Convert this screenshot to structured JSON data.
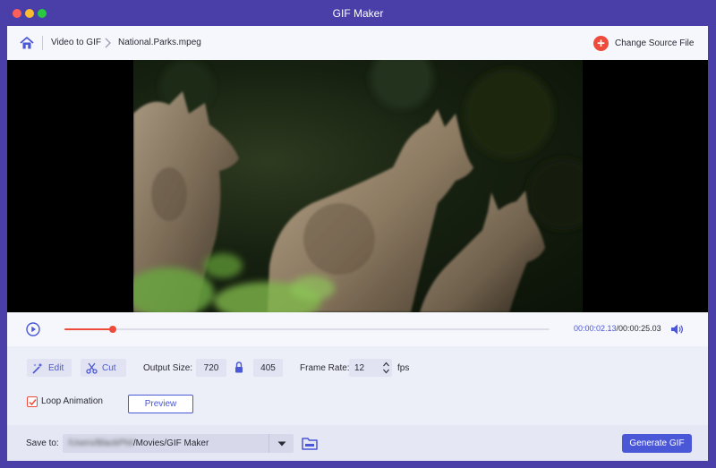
{
  "window": {
    "title": "GIF Maker"
  },
  "nav": {
    "home_icon": "home-icon",
    "breadcrumb": [
      "Video to GIF",
      "National.Parks.mpeg"
    ],
    "change_source_label": "Change Source File"
  },
  "player": {
    "current_time": "00:00:02.13",
    "total_time": "/00:00:25.03",
    "progress": 0.1,
    "accent": "#ef4b3c"
  },
  "controls": {
    "edit_label": "Edit",
    "cut_label": "Cut",
    "output_size_label": "Output Size:",
    "width": "720",
    "height": "405",
    "frame_rate_label": "Frame Rate:",
    "frame_rate": "12",
    "fps_label": "fps",
    "loop_label": "Loop Animation",
    "loop_checked": true,
    "preview_label": "Preview"
  },
  "footer": {
    "save_to_label": "Save to:",
    "path_blurred": "/Users/BlackPhil",
    "path_visible": "/Movies/GIF Maker",
    "generate_label": "Generate GIF"
  },
  "colors": {
    "brand": "#4a3fa8",
    "primary": "#4a57d6"
  }
}
